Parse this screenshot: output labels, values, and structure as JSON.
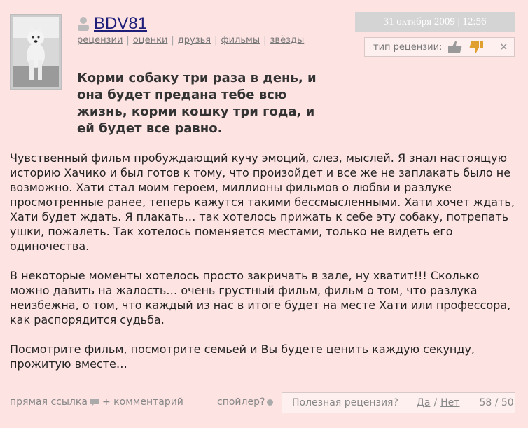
{
  "author": {
    "name": "BDV81",
    "links": [
      "рецензии",
      "оценки",
      "друзья",
      "фильмы",
      "звёзды"
    ]
  },
  "icons": {
    "avatar": "dog-photo",
    "user": "user-icon",
    "thumb_up": "thumb-up-icon",
    "thumb_down": "thumb-down-icon",
    "close": "close-icon",
    "comment": "comment-icon",
    "spoiler": "spoiler-dot-icon"
  },
  "date": "31 октября 2009 | 12:56",
  "review_type": {
    "label": "тип рецензии:",
    "close": "×"
  },
  "review": {
    "title": "Корми собаку три раза в день, и она будет предана тебе всю жизнь, корми кошку три года, и ей будет все равно.",
    "paragraphs": [
      "Чувственный фильм пробуждающий кучу эмоций, слез, мыслей. Я знал настоящую историю Хачико и был готов к тому, что произойдет и все же не заплакать было не возможно. Хати стал моим героем, миллионы фильмов о любви и разлуке просмотренные ранее, теперь кажутся такими бессмысленными. Хати хочет ждать, Хати будет ждать. Я плакать… так хотелось прижать к себе эту собаку, потрепать ушки, пожалеть. Так хотелось поменяется местами, только не видеть его одиночества.",
      "В некоторые моменты хотелось просто закричать в зале, ну хватит!!! Сколько можно давить на жалость… очень грустный фильм, фильм о том, что разлука неизбежна, о том, что каждый из нас в итоге будет на месте Хати или профессора, как распорядится судьба.",
      "Посмотрите фильм, посмотрите семьей и Вы будете ценить каждую секунду, прожитую вместе…"
    ]
  },
  "footer": {
    "direct_link": "прямая ссылка",
    "add_comment": "+ комментарий",
    "spoiler": "спойлер?",
    "useful_question": "Полезная рецензия?",
    "yes": "Да",
    "slash": "/",
    "no": "Нет",
    "score": "58 / 50"
  },
  "colors": {
    "background": "#fee3e3",
    "author_link": "#1f1f7a",
    "date_badge": "#d4d4d4"
  }
}
